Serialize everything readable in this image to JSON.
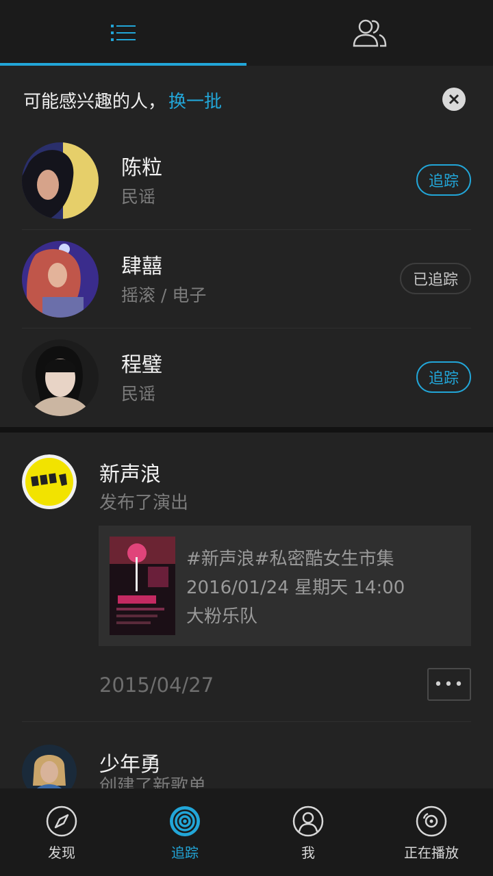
{
  "top_tabs": [
    {
      "icon": "list-icon",
      "active": true
    },
    {
      "icon": "people-icon",
      "active": false
    }
  ],
  "suggest": {
    "title": "可能感兴趣的人，",
    "refresh": "换一批",
    "people": [
      {
        "name": "陈粒",
        "genre": "民谣",
        "follow": "追踪",
        "followed": false
      },
      {
        "name": "肆囍",
        "genre": "摇滚 / 电子",
        "follow": "已追踪",
        "followed": true
      },
      {
        "name": "程璧",
        "genre": "民谣",
        "follow": "追踪",
        "followed": false
      }
    ]
  },
  "feed": [
    {
      "name": "新声浪",
      "action": "发布了演出",
      "event": {
        "title": " #新声浪#私密酷女生市集",
        "datetime": "2016/01/24 星期天 14:00",
        "artist": "大粉乐队"
      },
      "date": "2015/04/27",
      "more": "•••"
    },
    {
      "name": "少年勇",
      "action": "创建了新歌单"
    }
  ],
  "nav": [
    {
      "label": "发现",
      "icon": "compass-icon"
    },
    {
      "label": "追踪",
      "icon": "target-icon"
    },
    {
      "label": "我",
      "icon": "user-icon"
    },
    {
      "label": "正在播放",
      "icon": "disc-icon"
    }
  ],
  "colors": {
    "accent": "#22a6d8",
    "background": "#232323"
  }
}
